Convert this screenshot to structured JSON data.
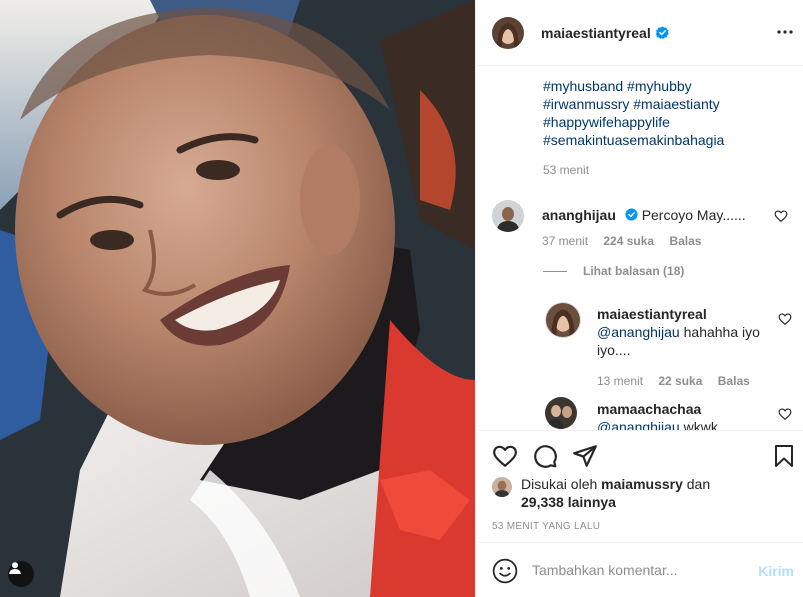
{
  "post": {
    "author": "maiaestiantyreal",
    "verified": true
  },
  "caption": {
    "hashtags": [
      "#myhusband #myhubby",
      "#irwanmussry #maiaestianty",
      "#happywifehappylife",
      "#semakintuasemakinbahagia"
    ],
    "time": "53 menit"
  },
  "comments": [
    {
      "user": "ananghijau",
      "verified": true,
      "text": "Percoyo May......",
      "time": "37 menit",
      "likes": "224 suka",
      "reply_label": "Balas"
    }
  ],
  "view_replies": "Lihat balasan (18)",
  "replies": [
    {
      "user": "maiaestiantyreal",
      "mention": "@ananghijau",
      "text": "hahahha iyo iyo....",
      "time": "13 menit",
      "likes": "22 suka",
      "reply_label": "Balas"
    },
    {
      "user": "mamaachachaa",
      "mention": "@ananghijau",
      "text": "wkwk"
    }
  ],
  "likes": {
    "prefix": "Disukai oleh",
    "user": "maiamussry",
    "conj": "dan",
    "count": "29,338 lainnya"
  },
  "post_time": "53 MENIT YANG LALU",
  "comment_box": {
    "placeholder": "Tambahkan komentar...",
    "post_label": "Kirim"
  },
  "icons": {
    "header": [
      "verified-badge-icon",
      "more-options-icon"
    ],
    "actions": [
      "heart-icon",
      "comment-icon",
      "share-icon",
      "bookmark-icon"
    ],
    "other": [
      "user-tag-icon",
      "emoji-icon"
    ]
  },
  "colors": {
    "link": "#00376b",
    "verified": "#0095f6",
    "muted": "#8e8e8e",
    "post_button_disabled": "#b2dffc"
  }
}
